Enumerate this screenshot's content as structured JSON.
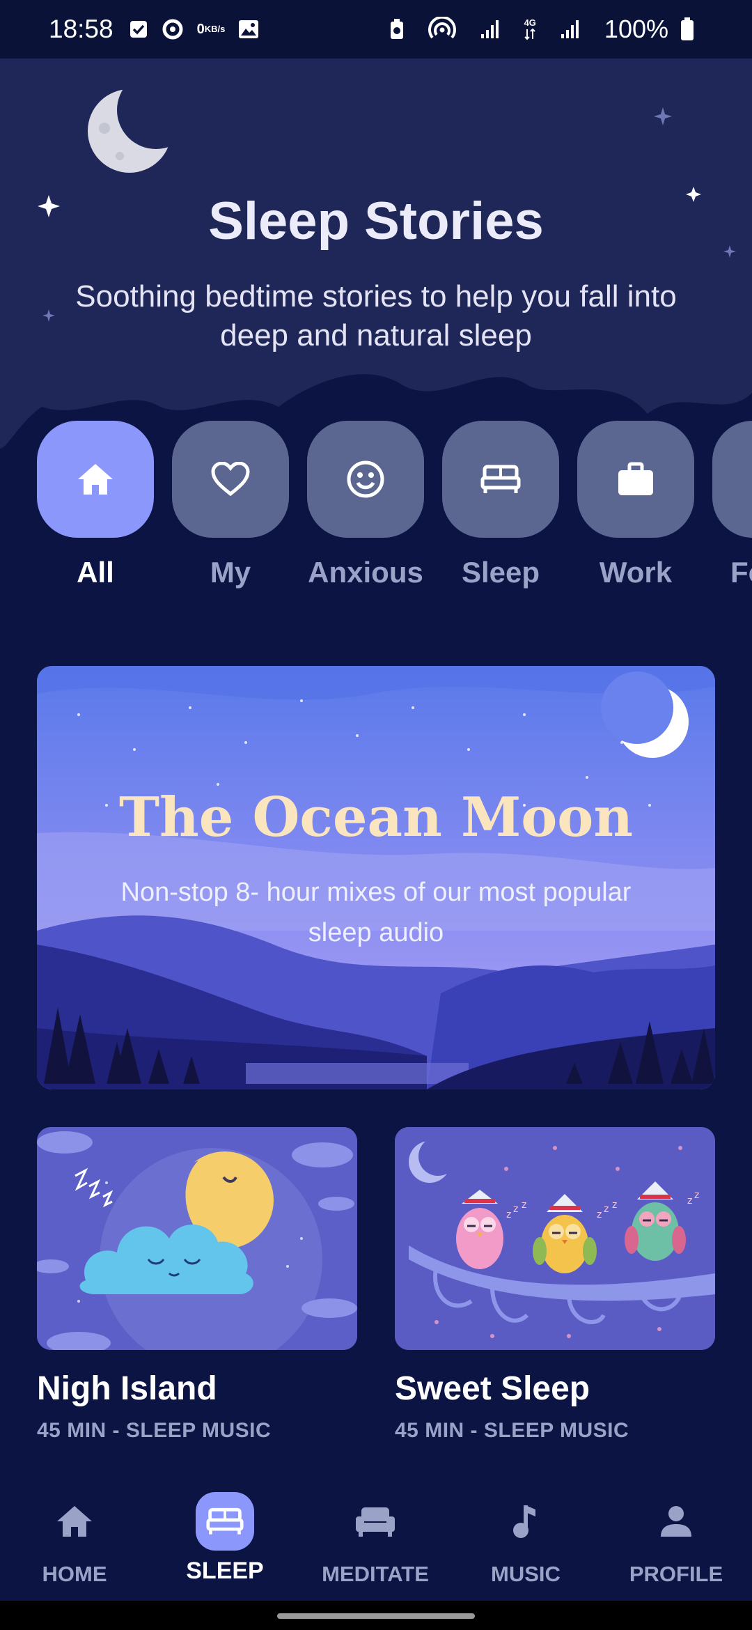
{
  "status_bar": {
    "time": "18:58",
    "net_speed_value": "0",
    "net_speed_unit": "KB/s",
    "signal_type": "4G",
    "battery": "100%"
  },
  "hero": {
    "title": "Sleep Stories",
    "subtitle": "Soothing bedtime stories to help you fall into deep and natural sleep"
  },
  "categories": [
    {
      "label": "All",
      "icon": "home-icon",
      "active": true
    },
    {
      "label": "My",
      "icon": "heart-icon",
      "active": false
    },
    {
      "label": "Anxious",
      "icon": "smiley-icon",
      "active": false
    },
    {
      "label": "Sleep",
      "icon": "bed-icon",
      "active": false
    },
    {
      "label": "Work",
      "icon": "briefcase-icon",
      "active": false
    },
    {
      "label": "Fo",
      "icon": "partial-icon",
      "active": false
    }
  ],
  "featured": {
    "title": "The Ocean Moon",
    "subtitle": "Non-stop 8- hour mixes of our most popular sleep audio"
  },
  "cards": [
    {
      "title": "Nigh Island",
      "meta": "45 MIN - SLEEP MUSIC"
    },
    {
      "title": "Sweet Sleep",
      "meta": "45 MIN - SLEEP MUSIC"
    }
  ],
  "bottom_nav": [
    {
      "label": "HOME",
      "icon": "home-icon",
      "active": false
    },
    {
      "label": "SLEEP",
      "icon": "bed-icon",
      "active": true
    },
    {
      "label": "MEDITATE",
      "icon": "sofa-icon",
      "active": false
    },
    {
      "label": "MUSIC",
      "icon": "music-note-icon",
      "active": false
    },
    {
      "label": "PROFILE",
      "icon": "person-icon",
      "active": false
    }
  ],
  "colors": {
    "background": "#0b1442",
    "hero": "#1f2658",
    "accent": "#8b97fa",
    "tile": "#5b6791",
    "muted_text": "#9aa3c7",
    "feature_title": "#fbe5bf"
  }
}
